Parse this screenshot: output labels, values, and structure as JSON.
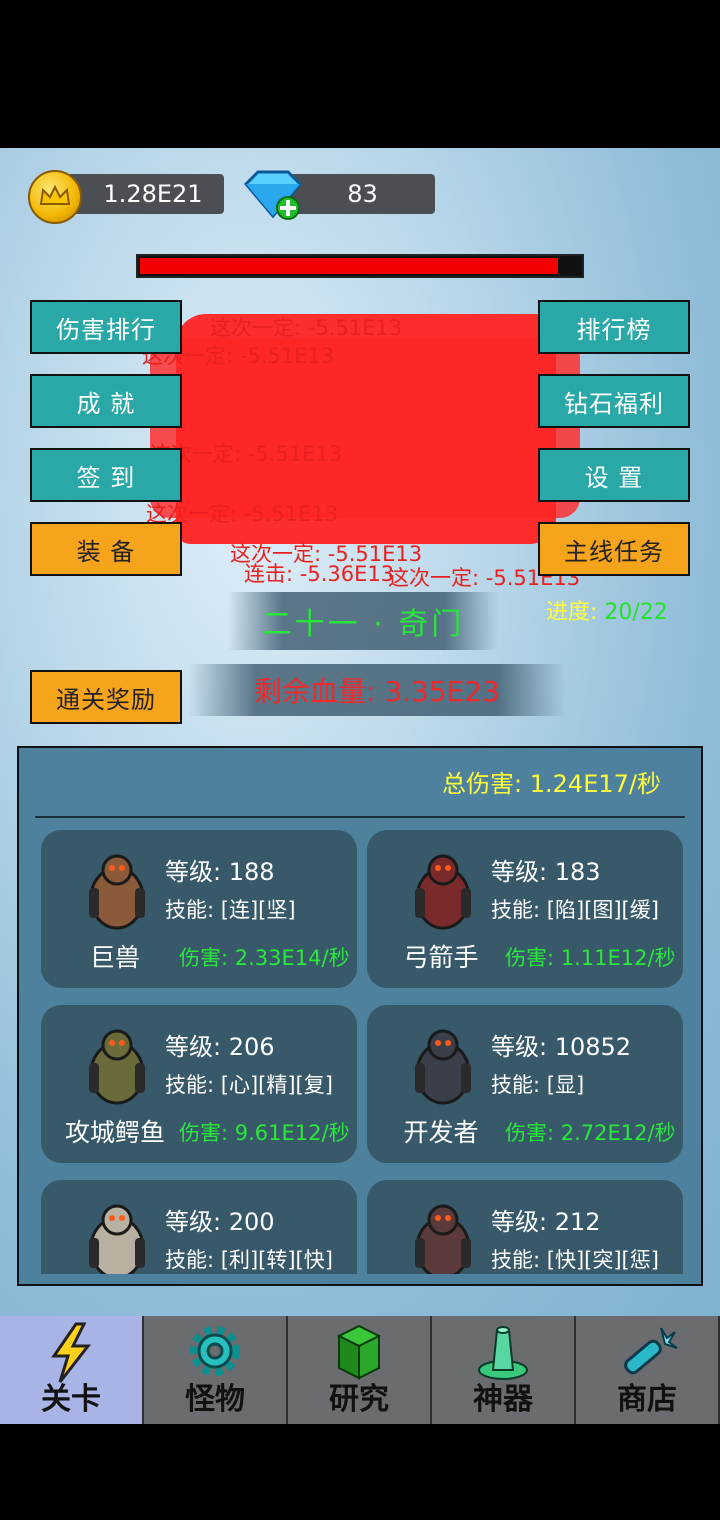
{
  "currency": {
    "gold": "1.28E21",
    "diamonds": "83"
  },
  "boss": {
    "hp_fraction": 0.95
  },
  "buttons": {
    "damage_rank": "伤害排行",
    "achievements": "成 就",
    "checkin": "签 到",
    "equipment": "装 备",
    "leaderboard": "排行榜",
    "diamond_welfare": "钻石福利",
    "settings": "设 置",
    "main_quest": "主线任务",
    "clear_reward": "通关奖励"
  },
  "damage_popups": [
    "这次一定: -5.51E13",
    "这次一定: -5.51E13",
    "这次一定: -5.51E13",
    "这次一定: -5.51E13",
    "这次一定: -5.51E13",
    "连击: -5.36E13",
    "这次一定: -5.51E13"
  ],
  "stage": {
    "name": "二十一 · 奇门",
    "progress_label": "进度: ",
    "progress_value": "20/22"
  },
  "boss_hp_text": "剩余血量: 3.35E23",
  "total_damage": "总伤害: 1.24E17/秒",
  "monsters": [
    {
      "name": "巨兽",
      "level": "等级: 188",
      "skills": "技能: [连][坚]",
      "damage": "伤害: 2.33E14/秒",
      "color": "#8a5a3a"
    },
    {
      "name": "弓箭手",
      "level": "等级: 183",
      "skills": "技能: [陷][图][缓]",
      "damage": "伤害: 1.11E12/秒",
      "color": "#7a2a2a"
    },
    {
      "name": "攻城鳄鱼",
      "level": "等级: 206",
      "skills": "技能: [心][精][复]",
      "damage": "伤害: 9.61E12/秒",
      "color": "#6b6a3a"
    },
    {
      "name": "开发者",
      "level": "等级: 10852",
      "skills": "技能: [显]",
      "damage": "伤害: 2.72E12/秒",
      "color": "#3a3f4a"
    },
    {
      "name": "",
      "level": "等级: 200",
      "skills": "技能: [利][转][快]",
      "damage": "",
      "color": "#b8b0a0"
    },
    {
      "name": "",
      "level": "等级: 212",
      "skills": "技能: [快][突][惩]",
      "damage": "",
      "color": "#5a3a3a"
    }
  ],
  "nav": [
    {
      "label": "关卡",
      "icon": "lightning-icon",
      "active": true
    },
    {
      "label": "怪物",
      "icon": "gear-icon",
      "active": false
    },
    {
      "label": "研究",
      "icon": "blocks-icon",
      "active": false
    },
    {
      "label": "神器",
      "icon": "artifact-icon",
      "active": false
    },
    {
      "label": "商店",
      "icon": "shop-icon",
      "active": false
    }
  ],
  "colors": {
    "teal_button": "#2aa8a8",
    "orange_button": "#f7a41d",
    "damage_green": "#2ae83a",
    "boss_red": "#f40000"
  }
}
